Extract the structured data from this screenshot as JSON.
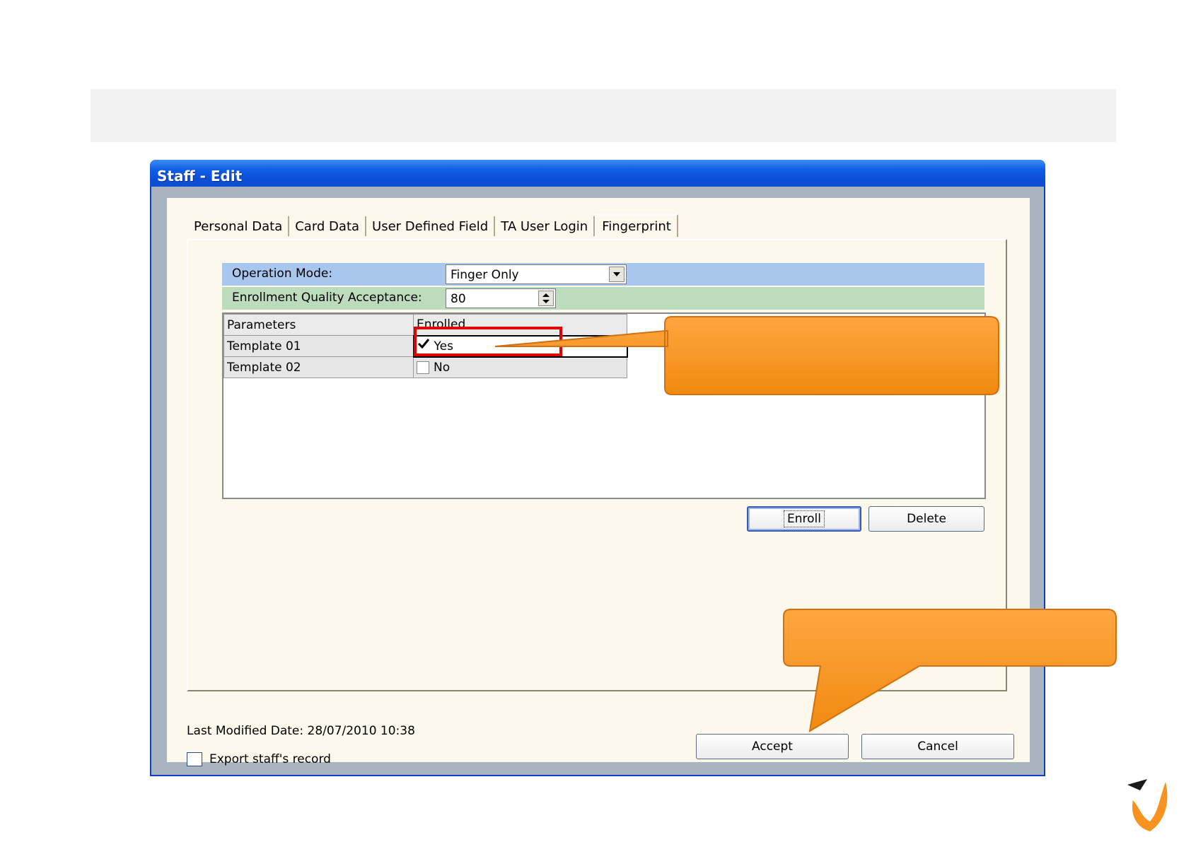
{
  "window": {
    "title": "Staff - Edit"
  },
  "tabs": [
    {
      "label": "Personal Data"
    },
    {
      "label": "Card Data"
    },
    {
      "label": "User Defined Field"
    },
    {
      "label": "TA User Login"
    },
    {
      "label": "Fingerprint",
      "active": true
    }
  ],
  "operation_mode": {
    "label": "Operation Mode:",
    "value": "Finger Only",
    "icon": "chevron-down-icon"
  },
  "enrollment_quality": {
    "label": "Enrollment  Quality Acceptance:",
    "value": "80",
    "icon": "spinner-arrows-icon"
  },
  "grid": {
    "headers": [
      "Parameters",
      "Enrolled"
    ],
    "rows": [
      {
        "param": "Template 01",
        "enrolled": "Yes",
        "checked": true
      },
      {
        "param": "Template 02",
        "enrolled": "No",
        "checked": false
      }
    ]
  },
  "buttons": {
    "enroll": "Enroll",
    "delete": "Delete",
    "accept": "Accept",
    "cancel": "Cancel"
  },
  "footer": {
    "last_modified": "Last Modified Date: 28/07/2010 10:38",
    "export_label": "Export staff's record",
    "export_checked": false
  },
  "colors": {
    "titlebar": "#0a4fd6",
    "client_bg": "#fcf8ec",
    "operation_row": "#a9c6ef",
    "quality_row": "#bddcbd",
    "callout": "#f7931e",
    "highlight": "#e00000"
  }
}
